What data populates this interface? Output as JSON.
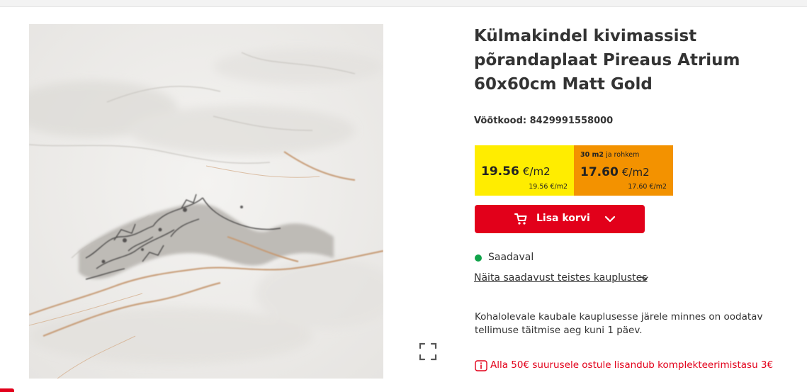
{
  "product": {
    "title": "Külmakindel kivimassist põrandaplaat Pireaus Atrium 60x60cm Matt Gold",
    "barcode_label": "Vöötkood:",
    "barcode_value": "8429991558000",
    "image_alt": "Marble tile image"
  },
  "pricing": {
    "regular": {
      "value": "19.56",
      "unit": "€/m2",
      "sub": "19.56 €/m2",
      "color": "#ffed00"
    },
    "bulk": {
      "threshold": "30 m2",
      "threshold_suffix": "ja rohkem",
      "value": "17.60",
      "unit": "€/m2",
      "sub": "17.60 €/m2",
      "color": "#f39200"
    }
  },
  "cart": {
    "button_label": "Lisa korvi",
    "icon": "cart-icon",
    "dropdown_icon": "chevron-down-icon",
    "color": "#e2001a"
  },
  "availability": {
    "status": "Saadaval",
    "status_color": "#10a34a",
    "other_stores_link": "Näita saadavust teistes kauplustes"
  },
  "info": {
    "pickup_text": "Kohalolevale kaubale kauplusesse järele minnes on oodatav tellimuse täitmise aeg kuni 1 päev."
  },
  "notice": {
    "icon": "info-icon",
    "text": "Alla 50€ suurusele ostule lisandub komplekteerimistasu 3€"
  },
  "gallery": {
    "expand_icon": "fullscreen-icon"
  }
}
